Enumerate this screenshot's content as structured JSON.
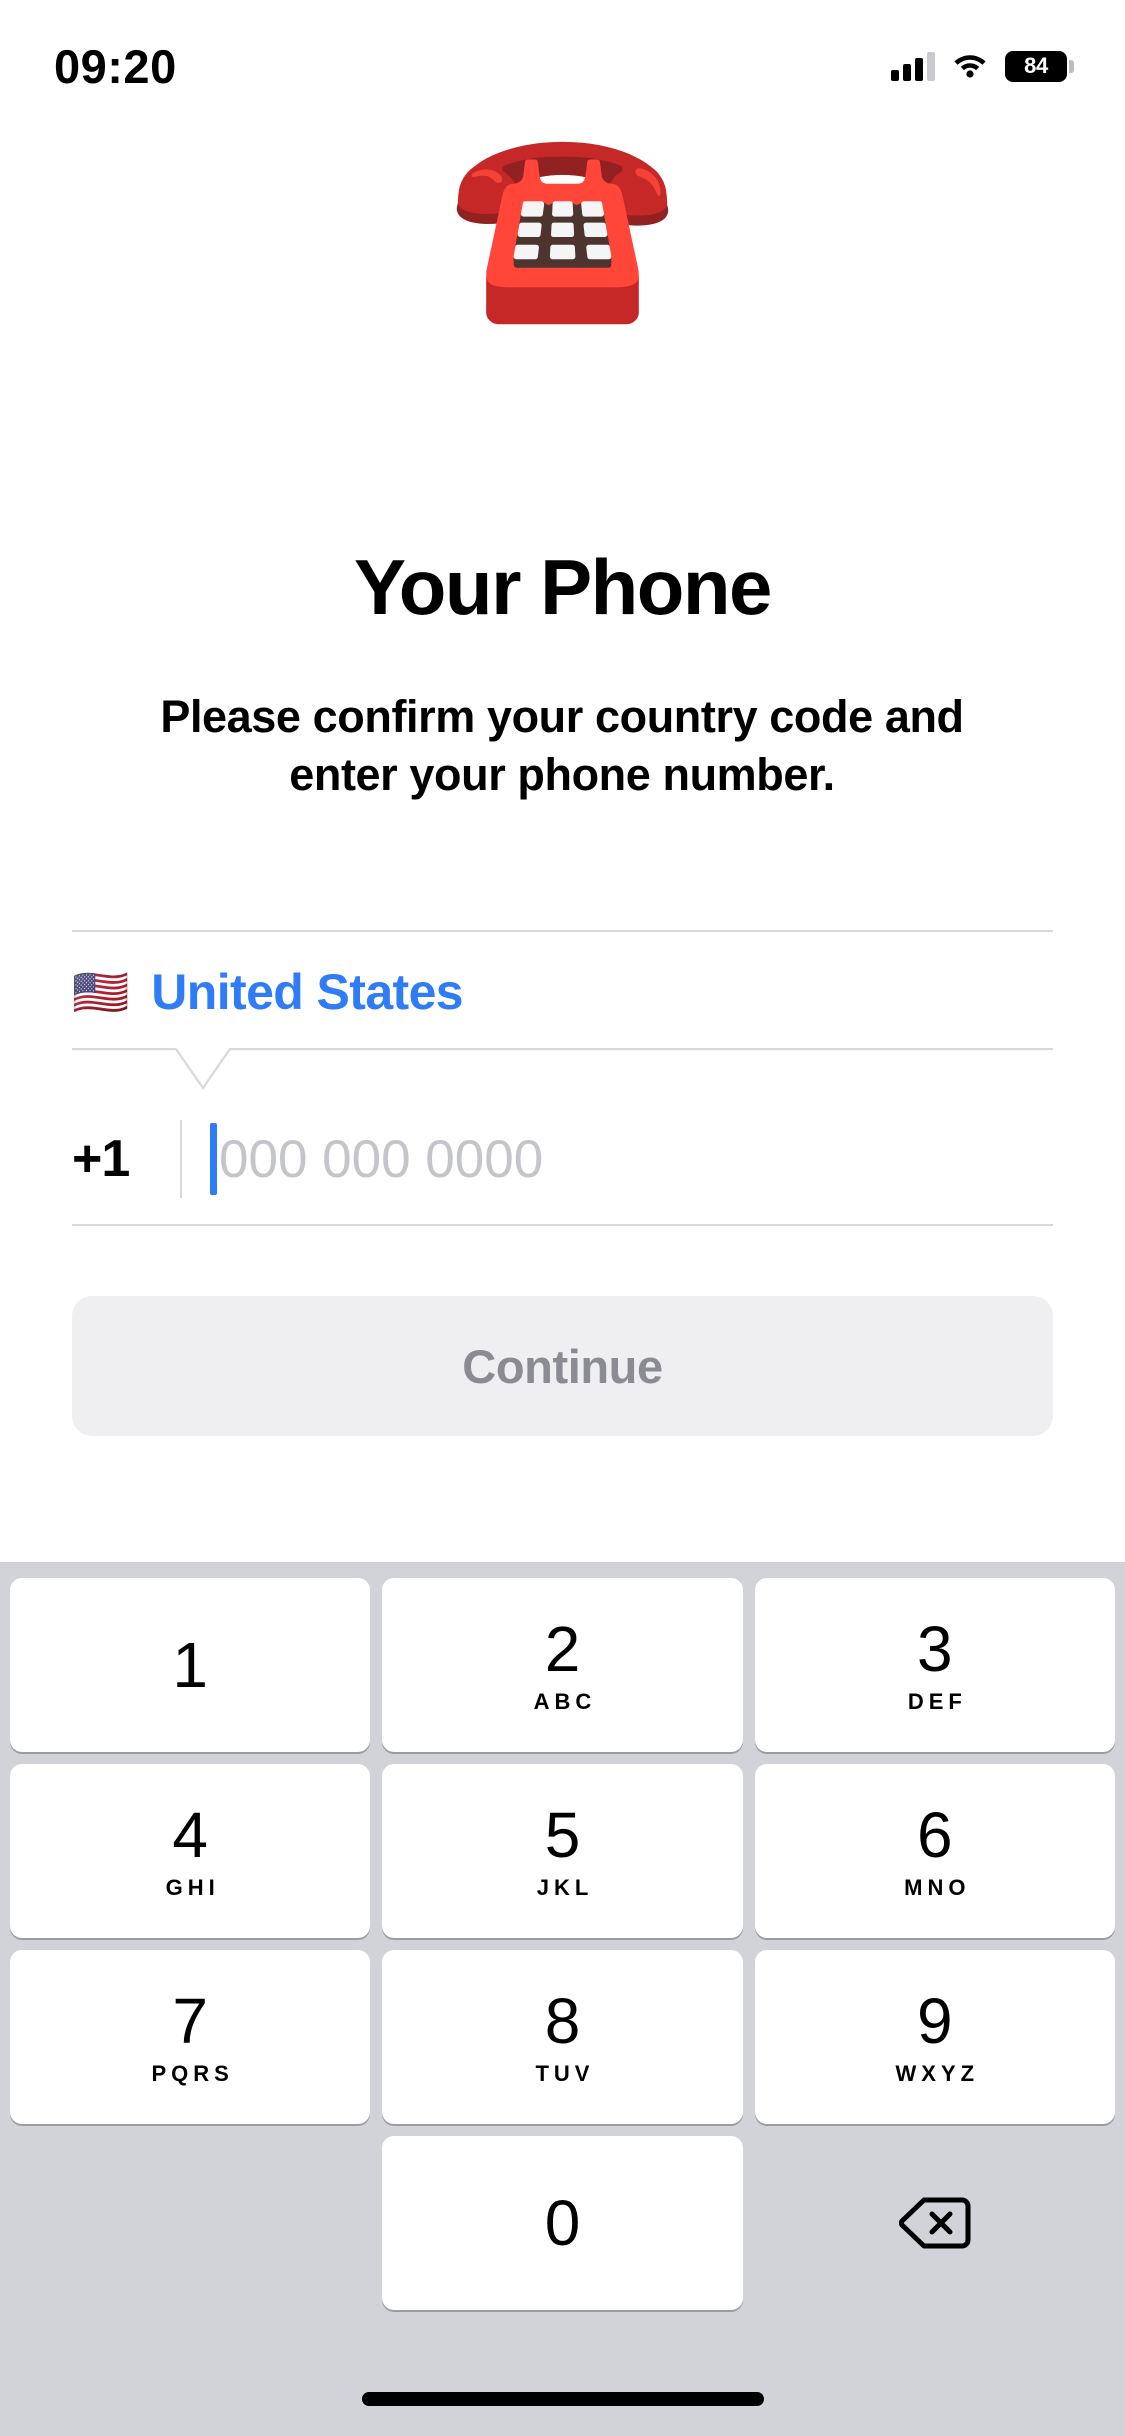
{
  "status_bar": {
    "time": "09:20",
    "battery_percent": "84",
    "cellular_icon": "signal-bars-icon",
    "wifi_icon": "wifi-icon",
    "battery_icon": "battery-icon"
  },
  "hero": {
    "emoji": "☎️",
    "icon_name": "telephone-emoji"
  },
  "header": {
    "title": "Your Phone",
    "subtitle": "Please confirm your country code and enter your phone number."
  },
  "form": {
    "country": {
      "flag": "🇺🇸",
      "name": "United States"
    },
    "phone": {
      "country_code": "+1",
      "placeholder": "000 000 0000",
      "value": ""
    },
    "continue_label": "Continue"
  },
  "keypad": {
    "rows": [
      [
        {
          "digit": "1",
          "letters": ""
        },
        {
          "digit": "2",
          "letters": "ABC"
        },
        {
          "digit": "3",
          "letters": "DEF"
        }
      ],
      [
        {
          "digit": "4",
          "letters": "GHI"
        },
        {
          "digit": "5",
          "letters": "JKL"
        },
        {
          "digit": "6",
          "letters": "MNO"
        }
      ],
      [
        {
          "digit": "7",
          "letters": "PQRS"
        },
        {
          "digit": "8",
          "letters": "TUV"
        },
        {
          "digit": "9",
          "letters": "WXYZ"
        }
      ],
      [
        {
          "digit": "",
          "letters": "",
          "blank": true
        },
        {
          "digit": "0",
          "letters": ""
        },
        {
          "digit": "",
          "letters": "",
          "delete": true
        }
      ]
    ],
    "delete_icon": "backspace-delete-icon"
  },
  "colors": {
    "accent_blue": "#2f7cf6",
    "placeholder_gray": "#c4c4cb",
    "divider": "#d8d8dc",
    "button_disabled_bg": "#efeff1",
    "button_disabled_text": "#8b8b92",
    "keypad_bg": "#d1d3d8",
    "key_bg": "#ffffff"
  }
}
